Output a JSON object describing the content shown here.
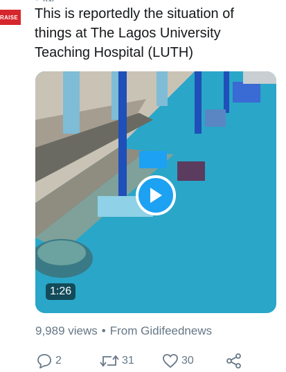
{
  "avatar": {
    "text": "RAISE"
  },
  "header": {
    "clipped_line": "• @ . . . . . . . ."
  },
  "tweet": {
    "lines": [
      "This is reportedly the situation of",
      "things at The Lagos University",
      "Teaching Hospital (LUTH)"
    ]
  },
  "media": {
    "duration": "1:26"
  },
  "meta": {
    "views": "9,989 views",
    "separator": "•",
    "source": "From Gidifeednews"
  },
  "actions": {
    "replies": "2",
    "retweets": "31",
    "likes": "30"
  },
  "colors": {
    "accent": "#1da1f2",
    "muted": "#657786",
    "floor": "#2aa6c8"
  }
}
